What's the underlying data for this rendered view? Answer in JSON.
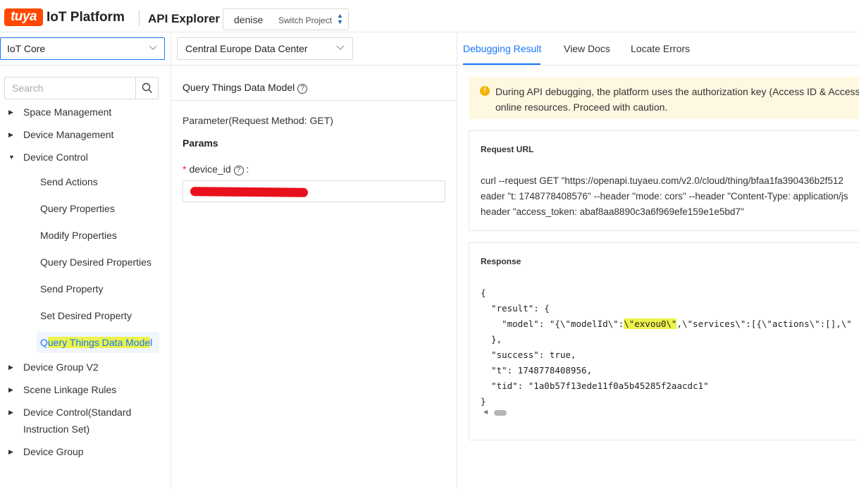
{
  "header": {
    "logo_text": "tuya",
    "platform_name": "IoT Platform",
    "section_title": "API Explorer",
    "project_name": "denise",
    "switch_project_label": "Switch Project"
  },
  "left": {
    "service_select": "IoT Core",
    "search_placeholder": "Search",
    "tree": [
      {
        "label": "Space Management",
        "expanded": false
      },
      {
        "label": "Device Management",
        "expanded": false
      },
      {
        "label": "Device Control",
        "expanded": true
      },
      {
        "label": "Device Group V2",
        "expanded": false
      },
      {
        "label": "Scene Linkage Rules",
        "expanded": false
      },
      {
        "label": "Device Control(Standard",
        "label_line2": "Instruction Set)",
        "expanded": false
      },
      {
        "label": "Device Group",
        "expanded": false
      }
    ],
    "device_control_children": [
      "Send Actions",
      "Query Properties",
      "Modify Properties",
      "Query Desired Properties",
      "Send Property",
      "Set Desired Property",
      "Query Things Data Model"
    ],
    "active_child": "Query Things Data Model",
    "active_child_prefix": "Q",
    "active_child_highlighted": "uery Things Data Mode",
    "active_child_suffix": "l"
  },
  "middle": {
    "datacenter_select": "Central Europe Data Center",
    "api_title": "Query Things Data Model",
    "parameter_method": "Parameter(Request Method: GET)",
    "params_label": "Params",
    "field_label": "device_id",
    "field_required": "*",
    "field_colon": ":"
  },
  "right": {
    "tabs": [
      "Debugging Result",
      "View Docs",
      "Locate Errors"
    ],
    "active_tab": "Debugging Result",
    "warning_line1": "During API debugging, the platform uses the authorization key (Access ID & Access",
    "warning_line2": "online resources. Proceed with caution.",
    "request_url_title": "Request URL",
    "request_url_lines": [
      "curl --request GET \"https://openapi.tuyaeu.com/v2.0/cloud/thing/bfaa1fa390436b2f512",
      "eader \"t: 1748778408576\" --header \"mode: cors\" --header \"Content-Type: application/js",
      "header \"access_token: abaf8aa8890c3a6f969efe159e1e5bd7\""
    ],
    "response_title": "Response",
    "response_lines": [
      "{",
      "  \"result\": {",
      "    \"model\": \"{\\\"modelId\\\":",
      "  },",
      "  \"success\": true,",
      "  \"t\": 1748778408956,",
      "  \"tid\": \"1a0b57f13ede11f0a5b45285f2aacdc1\"",
      "}"
    ],
    "model_highlight": "\\\"exvou0\\\"",
    "model_rest": ",\\\"services\\\":[{\\\"actions\\\":[],\\\""
  },
  "colors": {
    "brand": "#ff4800",
    "accent": "#1677ff",
    "highlight": "#ecf34b",
    "warning_bg": "#fff8e1",
    "warning_icon": "#f5b400",
    "redaction": "#e8101c"
  }
}
